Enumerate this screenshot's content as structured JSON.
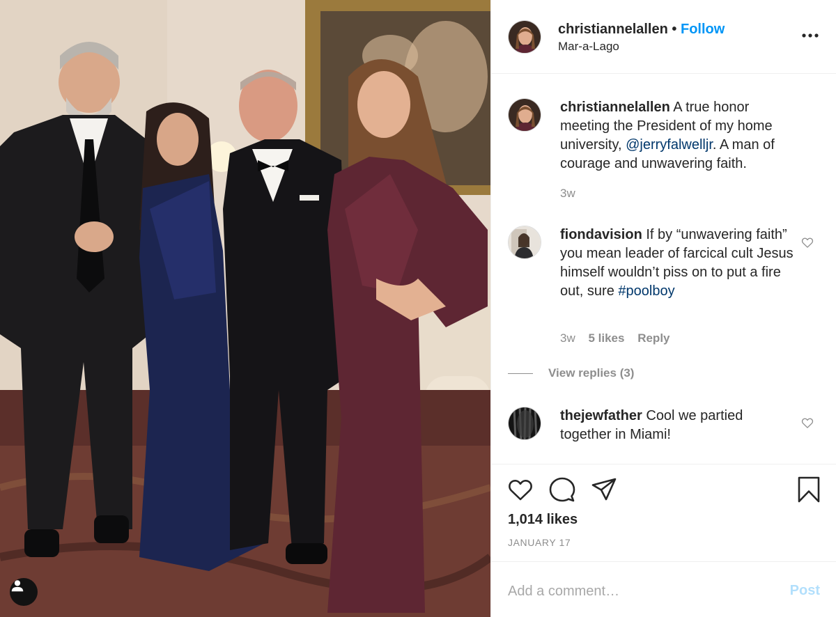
{
  "photo": {
    "description_icon": "user-tag-icon"
  },
  "header": {
    "username": "christiannelallen",
    "separator": "•",
    "follow_label": "Follow",
    "location": "Mar-a-Lago",
    "more_icon": "more-horizontal-icon"
  },
  "caption": {
    "username": "christiannelallen",
    "text_before": " A true honor meeting the President of my home university, ",
    "mention": "@jerryfalwelljr",
    "text_after": ". A man of courage and unwavering faith.",
    "time": "3w"
  },
  "comments": [
    {
      "username": "fiondavision",
      "text": " If by “unwavering faith” you mean leader of farcical cult Jesus himself wouldn’t piss on to put a fire out, sure ",
      "hashtag": "#poolboy",
      "time": "3w",
      "likes": "5 likes",
      "reply_label": "Reply",
      "view_replies": "View replies (3)"
    },
    {
      "username": "thejewfather",
      "text": " Cool we partied together in Miami!"
    }
  ],
  "actions": {
    "icons": [
      "heart-icon",
      "comment-icon",
      "share-icon",
      "bookmark-icon"
    ],
    "likes": "1,014 likes",
    "date": "JANUARY 17"
  },
  "add_comment": {
    "placeholder": "Add a comment…",
    "post_label": "Post"
  },
  "colors": {
    "accent": "#0095f6",
    "mention": "#00376b",
    "muted": "#8e8e8e",
    "post_disabled": "#b2dffc"
  }
}
